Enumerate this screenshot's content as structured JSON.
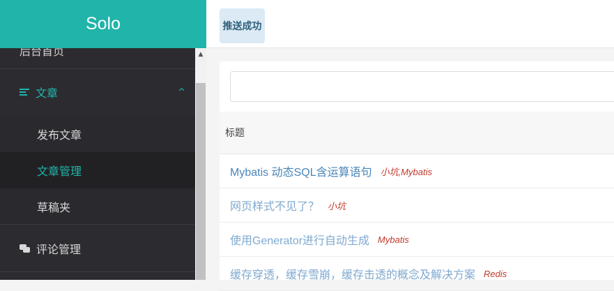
{
  "brand": "Solo",
  "toast": "推送成功",
  "sidebar": {
    "partial_item": "后台首页",
    "articles": {
      "label": "文章",
      "chevron": "^"
    },
    "sub_items": [
      {
        "label": "发布文章"
      },
      {
        "label": "文章管理"
      },
      {
        "label": "草稿夹"
      }
    ],
    "comments": {
      "label": "评论管理"
    }
  },
  "scroll_up": "▲",
  "search": {
    "value": "",
    "placeholder": ""
  },
  "table": {
    "header": "标题",
    "rows": [
      {
        "title": "Mybatis 动态SQL含运算语句",
        "tags": "小坑,Mybatis"
      },
      {
        "title": "网页样式不见了？",
        "tags": "小坑"
      },
      {
        "title": "使用Generator进行自动生成",
        "tags": "Mybatis"
      },
      {
        "title": "缓存穿透，缓存雪崩，缓存击透的概念及解决方案",
        "tags": "Redis"
      }
    ]
  },
  "colors": {
    "accent": "#20b4aa",
    "link": "#4a86b9",
    "tag": "#c0392b",
    "sidebar_bg": "#2c2c30"
  }
}
